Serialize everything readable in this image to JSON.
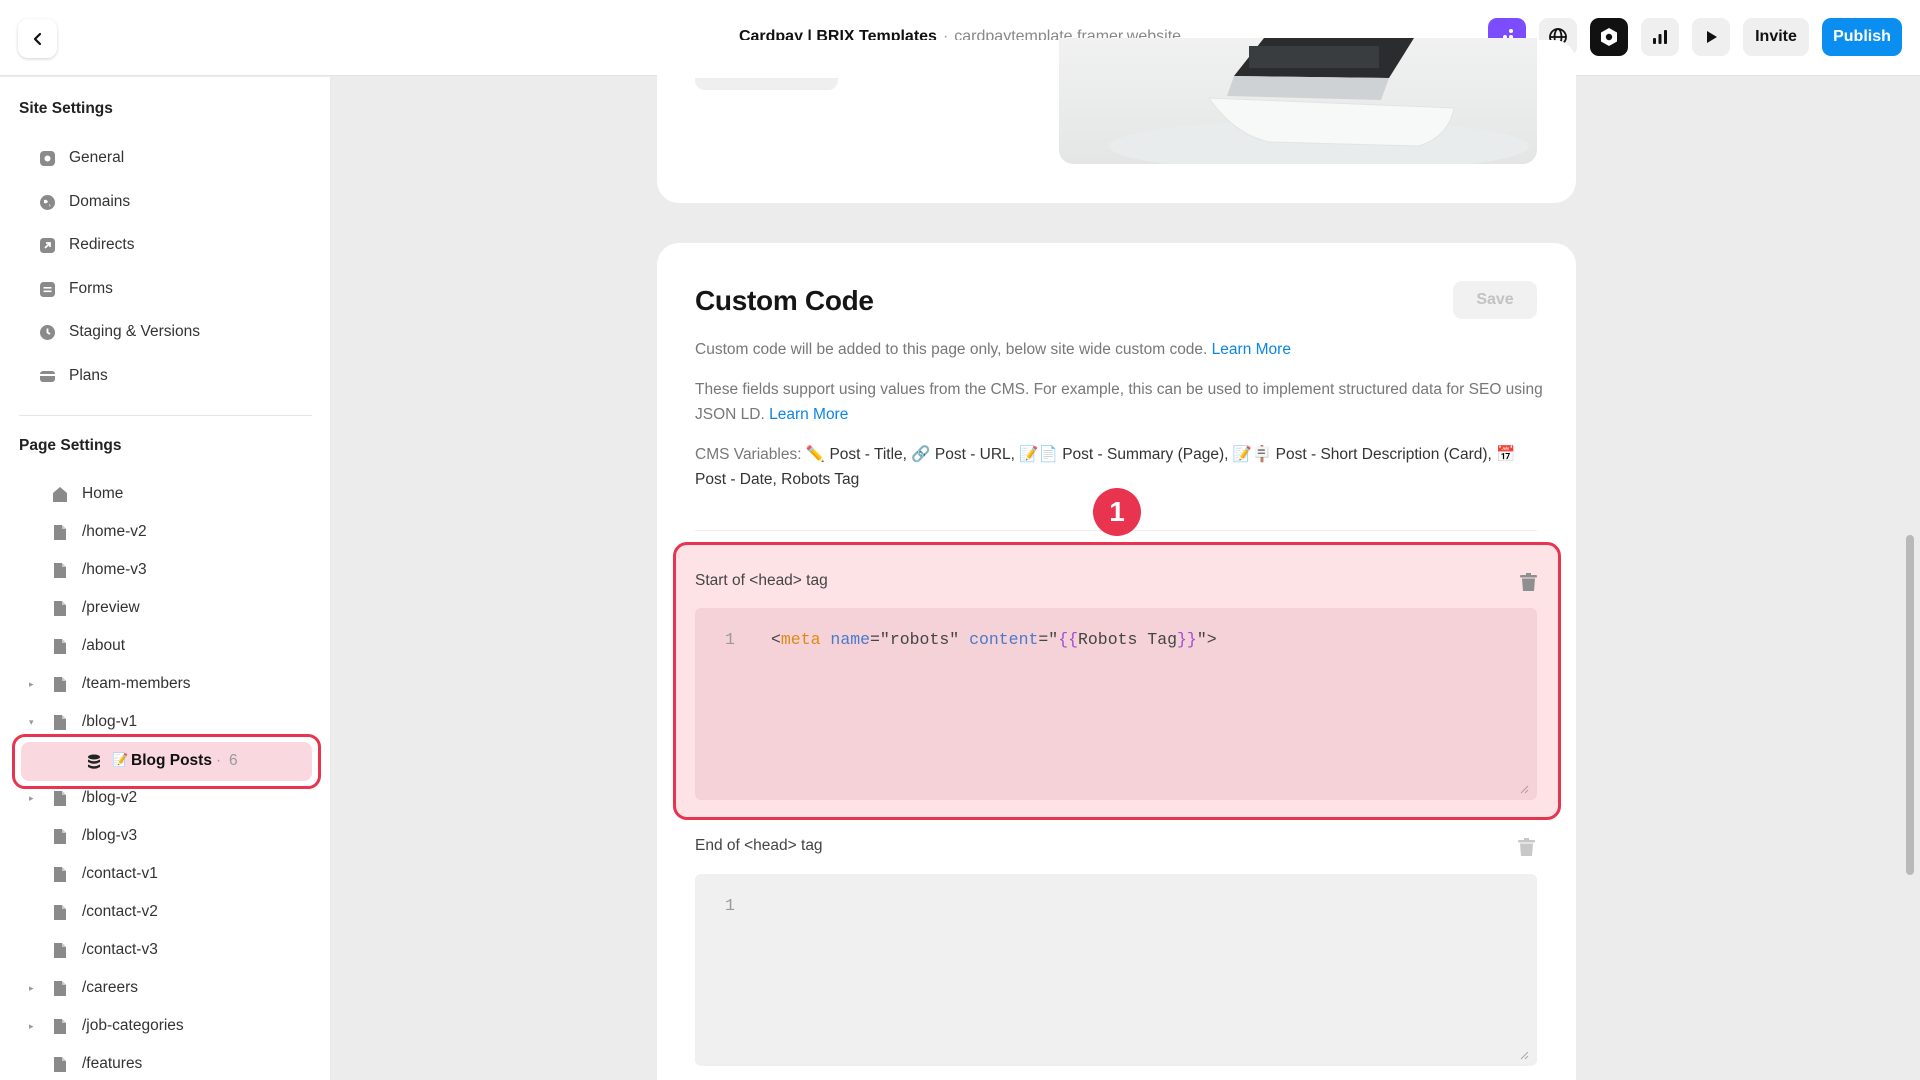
{
  "topbar": {
    "title": "Cardpay | BRIX Templates",
    "separator": "·",
    "url": "cardpaytemplate.framer.website",
    "invite_label": "Invite",
    "publish_label": "Publish",
    "colors": {
      "publish": "#0a8ff0",
      "accent_icon": "#7c4dff"
    },
    "icons": [
      "back-icon",
      "app-dots-icon",
      "globe-icon",
      "framer-logo-icon",
      "analytics-icon",
      "play-icon"
    ]
  },
  "sidebar": {
    "site_settings_title": "Site Settings",
    "site_items": [
      {
        "label": "General",
        "icon": "settings-icon"
      },
      {
        "label": "Domains",
        "icon": "globe-icon"
      },
      {
        "label": "Redirects",
        "icon": "redirect-icon"
      },
      {
        "label": "Forms",
        "icon": "form-icon"
      },
      {
        "label": "Staging & Versions",
        "icon": "clock-icon"
      },
      {
        "label": "Plans",
        "icon": "card-icon"
      }
    ],
    "page_settings_title": "Page Settings",
    "pages": [
      {
        "label": "Home",
        "icon": "home-icon"
      },
      {
        "label": "/home-v2"
      },
      {
        "label": "/home-v3"
      },
      {
        "label": "/preview"
      },
      {
        "label": "/about"
      },
      {
        "label": "/team-members",
        "caret": "▸"
      },
      {
        "label": "/blog-v1",
        "caret": "▾"
      },
      {
        "label": "Blog Posts",
        "emoji": "📝",
        "count_sep": "·",
        "count": "6"
      },
      {
        "label": "/blog-v2",
        "caret": "▸"
      },
      {
        "label": "/blog-v3"
      },
      {
        "label": "/contact-v1"
      },
      {
        "label": "/contact-v2"
      },
      {
        "label": "/contact-v3"
      },
      {
        "label": "/careers",
        "caret": "▸"
      },
      {
        "label": "/job-categories",
        "caret": "▸"
      },
      {
        "label": "/features"
      }
    ]
  },
  "custom_code": {
    "title": "Custom Code",
    "save_label": "Save",
    "desc1": "Custom code will be added to this page only, below site wide custom code.",
    "desc1_link": "Learn More",
    "desc2": "These fields support using values from the CMS. For example, this can be used to implement structured data for SEO using JSON LD.",
    "desc2_link": "Learn More",
    "cms_prefix": "CMS Variables:",
    "cms_variables": "✏️ Post - Title, 🔗 Post - URL, 📝📄 Post - Summary (Page), 📝🪧 Post - Short Description (Card), 📅 Post - Date, Robots Tag",
    "annotation_number": "1",
    "start_head_label": "Start of <head> tag",
    "start_head_line_no": "1",
    "code": {
      "open": "<",
      "tag": "meta",
      "attr1": "name",
      "eq1": "=\"robots\" ",
      "attr2": "content",
      "eq2": "=\"",
      "brace_open": "{{",
      "var": "Robots Tag",
      "brace_close": "}}",
      "close": "\">"
    },
    "end_head_label": "End of <head> tag",
    "end_head_line_no": "1",
    "colors": {
      "highlight": "#e8344e",
      "link": "#0b85e8"
    }
  }
}
